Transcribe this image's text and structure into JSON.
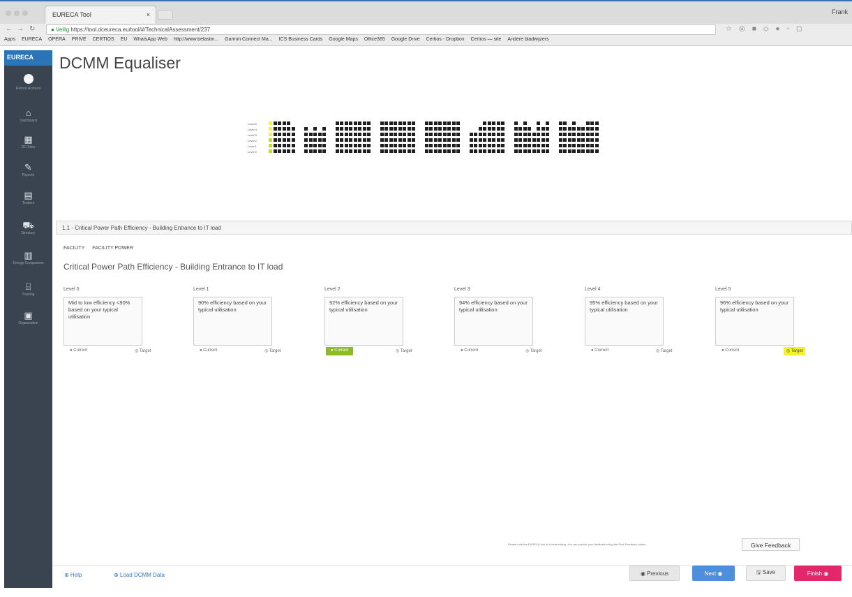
{
  "browser": {
    "tab_title": "EURECA Tool",
    "tab_close": "×",
    "user": "Frank",
    "address_secure": "● Veilig",
    "address_url": "https://tool.dceureca.eu/tool/#/TechnicalAssessment/237",
    "bookmarks": [
      "Apps",
      "EURECA",
      "OPERA",
      "PRIVE",
      "CERTIOS",
      "EU",
      "WhatsApp Web",
      "http://www.belastin...",
      "Garmin Connect Ma...",
      "ICS Business Cards",
      "Google Maps",
      "Office365",
      "Google Drive",
      "Certios - Dropbox",
      "Certios — site",
      "Andere bladwijzers"
    ]
  },
  "sidebar": {
    "logo": "EURECA",
    "items": [
      {
        "icon": "user-icon",
        "label": "Remco Account"
      },
      {
        "icon": "home-icon",
        "label": "Dashboard"
      },
      {
        "icon": "building-icon",
        "label": "DC Sites"
      },
      {
        "icon": "edit-icon",
        "label": "Reports"
      },
      {
        "icon": "table-icon",
        "label": "Tenders"
      },
      {
        "icon": "cart-icon",
        "label": "Directory"
      },
      {
        "icon": "chart-icon",
        "label": "Energy Comparison"
      },
      {
        "icon": "bank-icon",
        "label": "Training"
      },
      {
        "icon": "org-icon",
        "label": "Organisation"
      }
    ]
  },
  "page": {
    "title": "DCMM Equaliser"
  },
  "equaliser": {
    "level_labels": [
      "Level 5",
      "Level 4",
      "Level 3",
      "Level 2",
      "Level 1",
      "Level 0"
    ],
    "groups": [
      [
        [
          2,
          5
        ],
        [
          5
        ],
        [
          5
        ],
        [
          5
        ],
        [
          5
        ],
        [
          4
        ]
      ],
      [
        [
          4
        ],
        [
          3
        ],
        [
          4
        ],
        [
          3
        ],
        [
          4
        ]
      ],
      [
        [
          5
        ],
        [
          5
        ],
        [
          5
        ],
        [
          5
        ],
        [
          5
        ],
        [
          5
        ],
        [
          5
        ],
        [
          5
        ]
      ],
      [
        [
          5
        ],
        [
          5
        ],
        [
          5
        ],
        [
          5
        ],
        [
          5
        ],
        [
          5
        ],
        [
          5
        ],
        [
          5
        ]
      ],
      [
        [
          5
        ],
        [
          5
        ],
        [
          5
        ],
        [
          5
        ],
        [
          5
        ],
        [
          5
        ],
        [
          5
        ],
        [
          5
        ]
      ],
      [
        [
          3
        ],
        [
          3
        ],
        [
          4
        ],
        [
          5
        ],
        [
          5
        ],
        [
          5
        ],
        [
          5
        ],
        [
          5
        ]
      ],
      [
        [
          5
        ],
        [
          4
        ],
        [
          5
        ],
        [
          4
        ],
        [
          3
        ],
        [
          5
        ],
        [
          4
        ],
        [
          5
        ]
      ],
      [
        [
          5
        ],
        [
          5
        ],
        [
          4
        ],
        [
          5
        ],
        [
          4
        ],
        [
          4
        ],
        [
          5
        ],
        [
          5
        ],
        [
          5
        ]
      ]
    ],
    "colors": {
      "cell": "#1f1f1f",
      "current": "#c8dd22",
      "target": "#f3f33c"
    }
  },
  "question": {
    "header": "1.1 - Critical Power Path Efficiency - Building Entrance to IT load",
    "breadcrumbs": [
      "FACILITY",
      "FACILITY POWER"
    ],
    "title": "Critical Power Path Efficiency - Building Entrance to IT load",
    "current_label": "● Current",
    "target_label": "◎ Target",
    "levels": [
      {
        "label": "Level 0",
        "text": "Mid to low efficiency <90% based on your typical utilisation",
        "current": false,
        "target": false
      },
      {
        "label": "Level 1",
        "text": "90% efficiency based on your typical utilisation",
        "current": false,
        "target": false
      },
      {
        "label": "Level 2",
        "text": "92% efficiency based on your typical utilisation",
        "current": true,
        "target": false
      },
      {
        "label": "Level 3",
        "text": "94% efficiency based on your typical utilisation",
        "current": false,
        "target": false
      },
      {
        "label": "Level 4",
        "text": "95% efficiency based on your typical utilisation",
        "current": false,
        "target": false
      },
      {
        "label": "Level 5",
        "text": "96% efficiency based on your typical utilisation",
        "current": false,
        "target": true
      }
    ]
  },
  "footer": {
    "help": "⊕ Help",
    "load": "⊕ Load DCMM Data",
    "previous": "◉ Previous",
    "next": "Next ◉",
    "save": "🖫 Save",
    "finish": "Finish ◉",
    "note": "Please note the EURECA tool is in beta testing. You can provide your feedback using the Give Feedback button.",
    "give_feedback": "Give Feedback"
  }
}
